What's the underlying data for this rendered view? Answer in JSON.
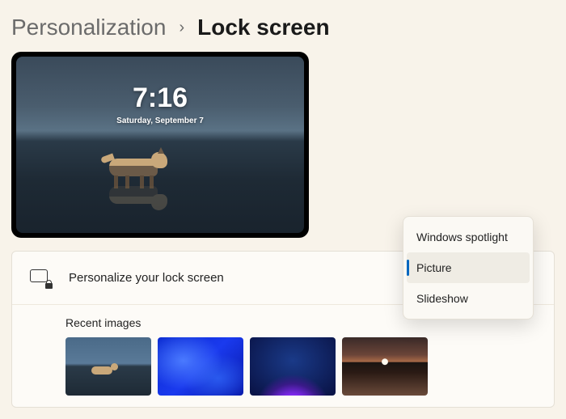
{
  "breadcrumb": {
    "parent": "Personalization",
    "separator": "›",
    "current": "Lock screen"
  },
  "preview": {
    "time": "7:16",
    "date": "Saturday, September 7"
  },
  "panel": {
    "personalize_label": "Personalize your lock screen"
  },
  "recent": {
    "title": "Recent images"
  },
  "dropdown": {
    "options": [
      {
        "label": "Windows spotlight"
      },
      {
        "label": "Picture"
      },
      {
        "label": "Slideshow"
      }
    ],
    "selected_index": 1
  }
}
